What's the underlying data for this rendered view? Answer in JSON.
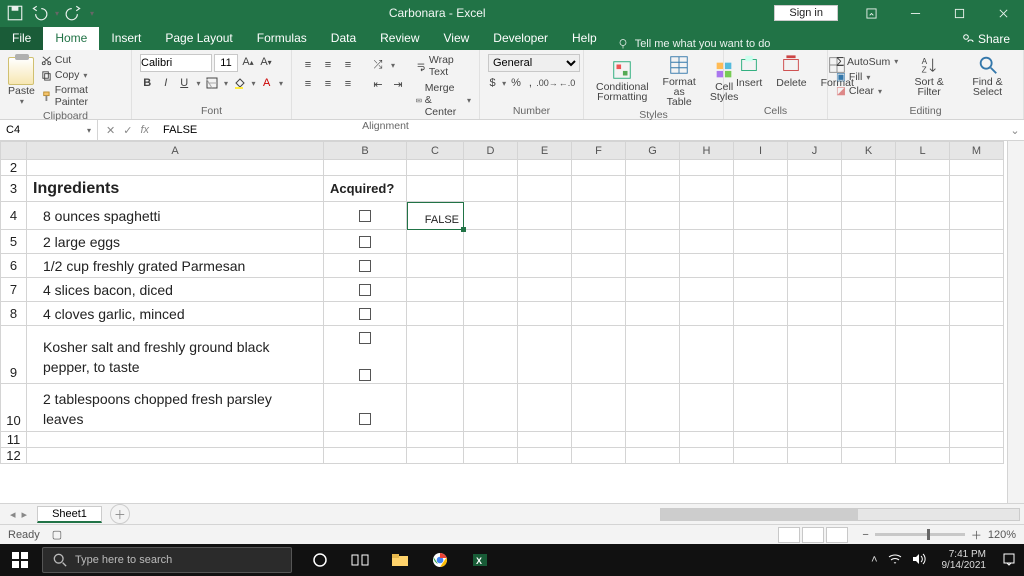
{
  "titlebar": {
    "title": "Carbonara  -  Excel",
    "signin": "Sign in"
  },
  "tabs": {
    "file": "File",
    "home": "Home",
    "insert": "Insert",
    "pagelayout": "Page Layout",
    "formulas": "Formulas",
    "data": "Data",
    "review": "Review",
    "view": "View",
    "developer": "Developer",
    "help": "Help",
    "tellme": "Tell me what you want to do",
    "share": "Share"
  },
  "ribbon": {
    "clipboard": {
      "label": "Clipboard",
      "paste": "Paste",
      "cut": "Cut",
      "copy": "Copy",
      "painter": "Format Painter"
    },
    "font": {
      "label": "Font",
      "family": "Calibri",
      "size": "11"
    },
    "alignment": {
      "label": "Alignment",
      "wrap": "Wrap Text",
      "merge": "Merge & Center"
    },
    "number": {
      "label": "Number",
      "format": "General"
    },
    "styles": {
      "label": "Styles",
      "cond": "Conditional Formatting",
      "table": "Format as Table",
      "cell": "Cell Styles"
    },
    "cells": {
      "label": "Cells",
      "insert": "Insert",
      "delete": "Delete",
      "format": "Format"
    },
    "editing": {
      "label": "Editing",
      "autosum": "AutoSum",
      "fill": "Fill",
      "clear": "Clear",
      "sort": "Sort & Filter",
      "find": "Find & Select"
    }
  },
  "fbar": {
    "name": "C4",
    "formula": "FALSE"
  },
  "columns": [
    "A",
    "B",
    "C",
    "D",
    "E",
    "F",
    "G",
    "H",
    "I",
    "J",
    "K",
    "L",
    "M"
  ],
  "cells": {
    "A3": "Ingredients",
    "B3": "Acquired?",
    "C4": "FALSE",
    "ingredients": [
      "8 ounces spaghetti",
      "2 large eggs",
      "1/2 cup freshly grated Parmesan",
      "4 slices bacon, diced",
      "4 cloves garlic, minced",
      "Kosher salt and freshly ground black pepper, to taste",
      "2 tablespoons chopped fresh parsley leaves"
    ]
  },
  "sheettab": "Sheet1",
  "status": {
    "ready": "Ready",
    "zoom": "120%"
  },
  "taskbar": {
    "search_placeholder": "Type here to search",
    "time": "7:41 PM",
    "date": "9/14/2021"
  }
}
